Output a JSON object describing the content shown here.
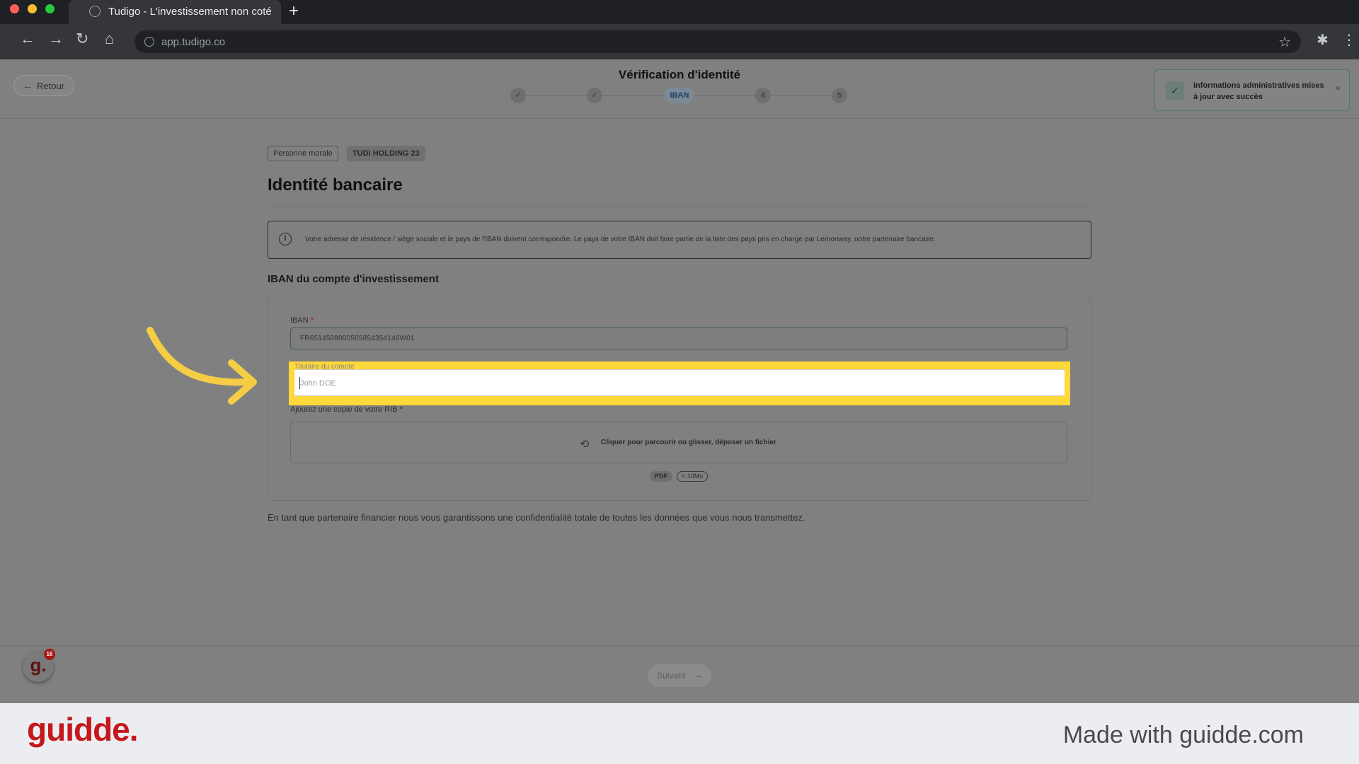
{
  "browser": {
    "tab_title": "Tudigo - L'investissement non coté",
    "url": "app.tudigo.co",
    "icons": [
      "globe-icon",
      "plus-icon",
      "back-icon",
      "forward-icon",
      "reload-icon",
      "home-icon",
      "star-icon",
      "extensions-icon",
      "menu-icon"
    ]
  },
  "header": {
    "back_label": "Retour",
    "title": "Vérification d'identité",
    "steps": [
      {
        "label": "✓",
        "state": "done"
      },
      {
        "label": "✓",
        "state": "done"
      },
      {
        "label": "IBAN",
        "state": "active"
      },
      {
        "label": "4",
        "state": "pending"
      },
      {
        "label": "5",
        "state": "pending"
      }
    ]
  },
  "toast": {
    "message": "Informations administratives mises à jour avec succès",
    "close": "×"
  },
  "main": {
    "badge_type": "Personne morale",
    "badge_name": "TUDI HOLDING 23",
    "title": "Identité bancaire",
    "info_text": "Votre adresse de résidence / siège sociale et le pays de l'IBAN doivent correspondre. Le pays de votre IBAN doit faire partie de la liste des pays pris en charge par Lemonway, notre partenaire bancaire.",
    "section_title": "IBAN du compte d'investissement",
    "iban_label": "IBAN",
    "iban_value": "FR6514508000505854354146W01",
    "holder_label": "Titulaire du compte",
    "holder_placeholder": "John DOE",
    "rib_label": "Ajoutez une copie de votre RIB",
    "required_mark": "*",
    "drop_text": "Cliquer pour parcourir ou glisser, déposer un fichier",
    "format_pill": "PDF",
    "size_pill": "< 10Mo",
    "confidentiality": "En tant que partenaire financier nous vous garantissons une confidentialité totale de toutes les données que vous nous transmettez."
  },
  "footer_bar": {
    "next_label": "Suivant",
    "avatar_letter": "g.",
    "notification_count": "16"
  },
  "watermark": {
    "logo": "guidde.",
    "made_with": "Made with guidde.com"
  },
  "colors": {
    "highlight": "#ffd83a",
    "arrow": "#f5cd45",
    "brand_red": "#c4181c"
  }
}
